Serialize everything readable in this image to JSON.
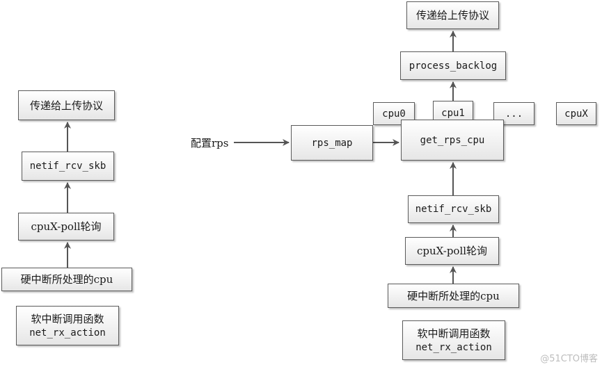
{
  "diagram": {
    "left": {
      "deliver_upper": "传递给上传协议",
      "netif_rcv_skb": "netif_rcv_skb",
      "cpux_poll": "cpuX-poll轮询",
      "hardirq_cpu": "硬中断所处理的cpu",
      "softirq_line1": "软中断调用函数",
      "softirq_line2": "net_rx_action"
    },
    "right": {
      "deliver_upper": "传递给上传协议",
      "process_backlog": "process_backlog",
      "cpus": [
        "cpu0",
        "cpu1",
        "...",
        "cpuX"
      ],
      "get_rps_cpu": "get_rps_cpu",
      "rps_map": "rps_map",
      "config_rps": "配置rps",
      "netif_rcv_skb": "netif_rcv_skb",
      "cpux_poll": "cpuX-poll轮询",
      "hardirq_cpu": "硬中断所处理的cpu",
      "softirq_line1": "软中断调用函数",
      "softirq_line2": "net_rx_action"
    },
    "edges": [
      {
        "from": "left.cpux_poll",
        "to": "left.netif_rcv_skb"
      },
      {
        "from": "left.netif_rcv_skb",
        "to": "left.deliver_upper"
      },
      {
        "from": "left.hardirq_cpu",
        "to": "left.cpux_poll"
      },
      {
        "from": "right.config_rps",
        "to": "right.rps_map"
      },
      {
        "from": "right.rps_map",
        "to": "right.get_rps_cpu"
      },
      {
        "from": "right.hardirq_cpu",
        "to": "right.cpux_poll"
      },
      {
        "from": "right.cpux_poll",
        "to": "right.netif_rcv_skb"
      },
      {
        "from": "right.netif_rcv_skb",
        "to": "right.get_rps_cpu"
      },
      {
        "from": "right.get_rps_cpu",
        "to": "right.cpu1"
      },
      {
        "from": "right.cpu1",
        "to": "right.process_backlog"
      },
      {
        "from": "right.process_backlog",
        "to": "right.deliver_upper"
      }
    ]
  },
  "watermark": "@51CTO博客"
}
